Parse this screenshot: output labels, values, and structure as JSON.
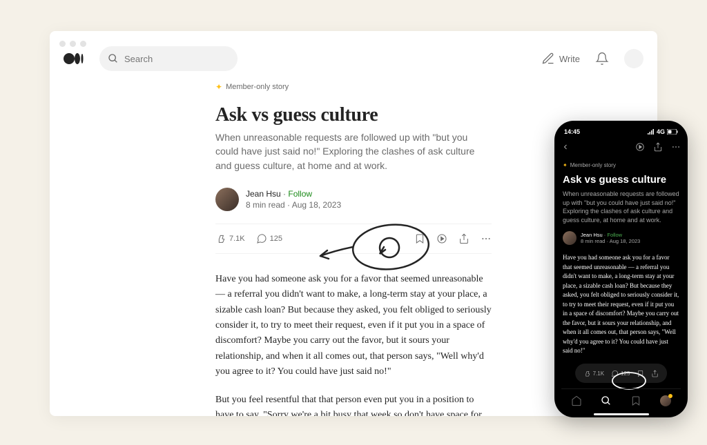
{
  "desktop": {
    "search_placeholder": "Search",
    "write_label": "Write"
  },
  "article": {
    "member_badge": "Member-only story",
    "title": "Ask vs guess culture",
    "subtitle": "When unreasonable requests are followed up with \"but you could have just said no!\" Exploring the clashes of ask culture and guess culture, at home and at work.",
    "author_name": "Jean Hsu",
    "follow_label": "Follow",
    "read_time": "8 min read",
    "publish_date": "Aug 18, 2023",
    "claps": "7.1K",
    "comments": "125",
    "body_p1": "Have you had someone ask you for a favor that seemed unreasonable — a referral you didn't want to make, a long-term stay at your place, a sizable cash loan? But because they asked, you felt obliged to seriously consider it, to try to meet their request, even if it put you in a space of discomfort? Maybe you carry out the favor, but it sours your relationship, and when it all comes out, that person says, \"Well why'd you agree to it? You could have just said no!\"",
    "body_p2": "But you feel resentful that that person even put you in a position to have to say, \"Sorry we're a bit busy that week so don't have space for you to stay with us,\" or \"I can't loan you that money at the moment\"?"
  },
  "mobile": {
    "time": "14:45",
    "network": "4G",
    "member_badge": "Member-only story",
    "title": "Ask vs guess culture",
    "subtitle": "When unreasonable requests are followed up with \"but you could have just said no!\" Exploring the clashes of ask culture and guess culture, at home and at work.",
    "author_name": "Jean Hsu",
    "follow_label": "Follow",
    "read_time": "8  min read",
    "publish_date": "Aug 18, 2023",
    "body": "Have you had someone ask you for a favor that seemed unreasonable — a referral you didn't want to make, a long-term stay at your place, a sizable cash loan? But because they asked, you felt obliged to seriously consider it, to try to meet their request, even if it put you in a space of discomfort? Maybe you carry out the favor, but it sours your relationship, and when it all comes out, that person says, \"Well why'd you agree to it? You could have just said no!\"",
    "claps": "7.1K",
    "comments": "125"
  }
}
